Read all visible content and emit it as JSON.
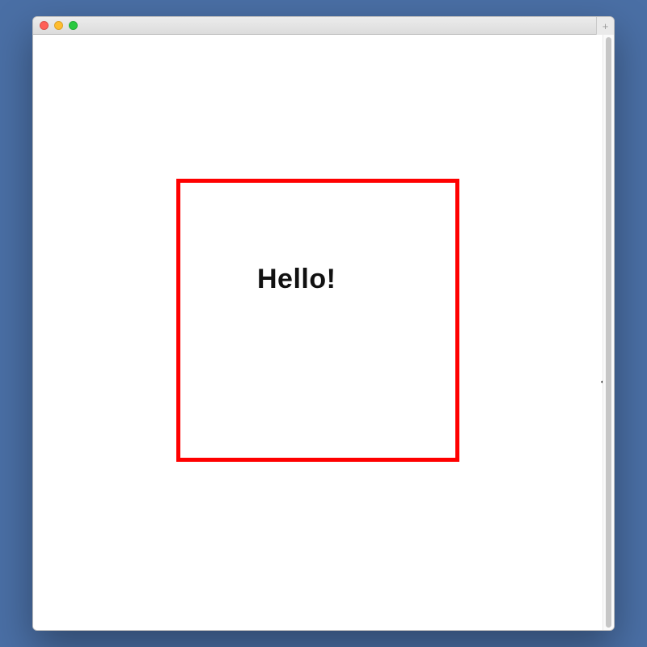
{
  "window": {
    "title": "",
    "plus_label": "+"
  },
  "content": {
    "box_text": "Hello!"
  },
  "cursor": {
    "glyph": "↔"
  },
  "colors": {
    "background": "#4a6fa5",
    "box_border": "#ff0000",
    "text": "#111111"
  }
}
